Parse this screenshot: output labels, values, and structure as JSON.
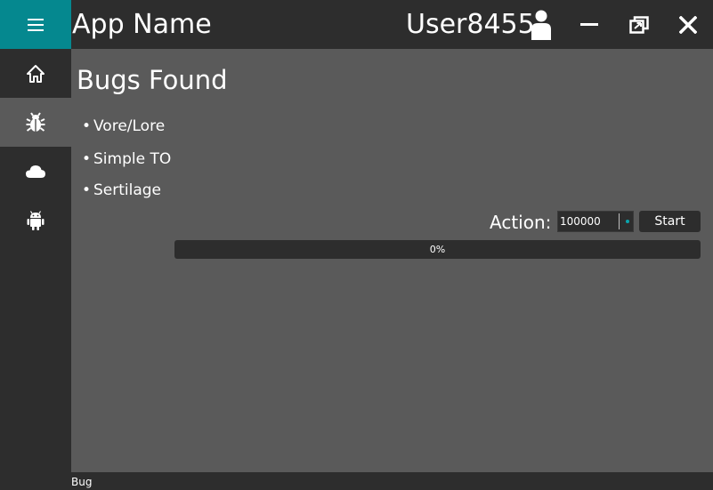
{
  "header": {
    "app_name": "App Name",
    "username": "User8455",
    "accent_color": "#05888f"
  },
  "icons": {
    "menu": "hamburger-menu-icon",
    "user": "user-icon",
    "minimize": "minimize-icon",
    "restore": "restore-icon",
    "close": "close-icon"
  },
  "sidebar": {
    "items": [
      {
        "name": "home",
        "icon": "home-icon",
        "active": false
      },
      {
        "name": "bug",
        "icon": "bug-icon",
        "active": true
      },
      {
        "name": "cloud",
        "icon": "cloud-icon",
        "active": false
      },
      {
        "name": "android",
        "icon": "android-icon",
        "active": false
      }
    ]
  },
  "main": {
    "title": "Bugs Found",
    "bugs": [
      "Vore/Lore",
      "Simple TO",
      "Sertilage"
    ],
    "action_label": "Action:",
    "action_value": "100000",
    "start_label": "Start",
    "progress": {
      "value": 0,
      "label": "0%"
    }
  },
  "status": {
    "text": "Bug"
  }
}
